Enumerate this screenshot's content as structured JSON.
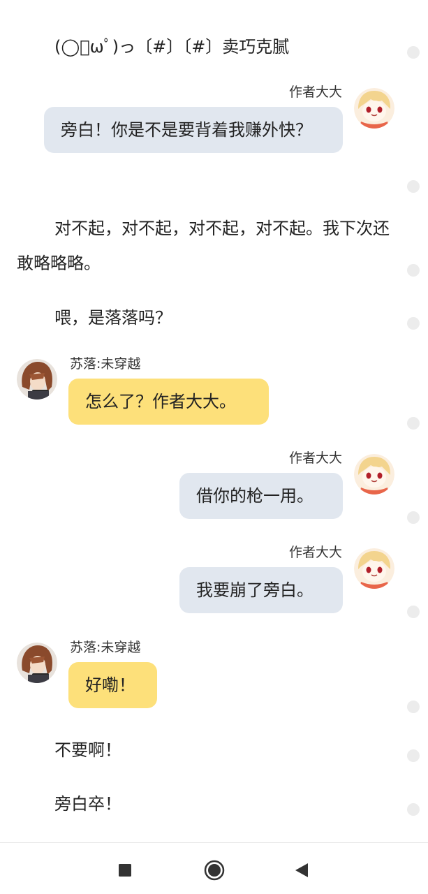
{
  "story": {
    "lines": [
      "(◯ﾟωﾟ)っ〔#〕〔#〕卖巧克腻",
      "对不起，对不起，对不起，对不起。我下次还敢略略略。",
      "喂，是落落吗？",
      "不要啊！",
      "旁白卒！"
    ]
  },
  "messages": [
    {
      "speaker": "作者大大",
      "text": "旁白！你是不是要背着我赚外快？"
    },
    {
      "speaker": "苏落:未穿越",
      "text": "怎么了？作者大大。"
    },
    {
      "speaker": "作者大大",
      "text": "借你的枪一用。"
    },
    {
      "speaker": "作者大大",
      "text": "我要崩了旁白。"
    },
    {
      "speaker": "苏落:未穿越",
      "text": "好嘞！"
    }
  ],
  "navbar": {
    "icons": [
      "square-recents-icon",
      "circle-home-icon",
      "triangle-back-icon"
    ]
  },
  "colors": {
    "author_bubble": "#e1e7ef",
    "character_bubble": "#fde07a",
    "paragraph_dot": "#ececec"
  }
}
